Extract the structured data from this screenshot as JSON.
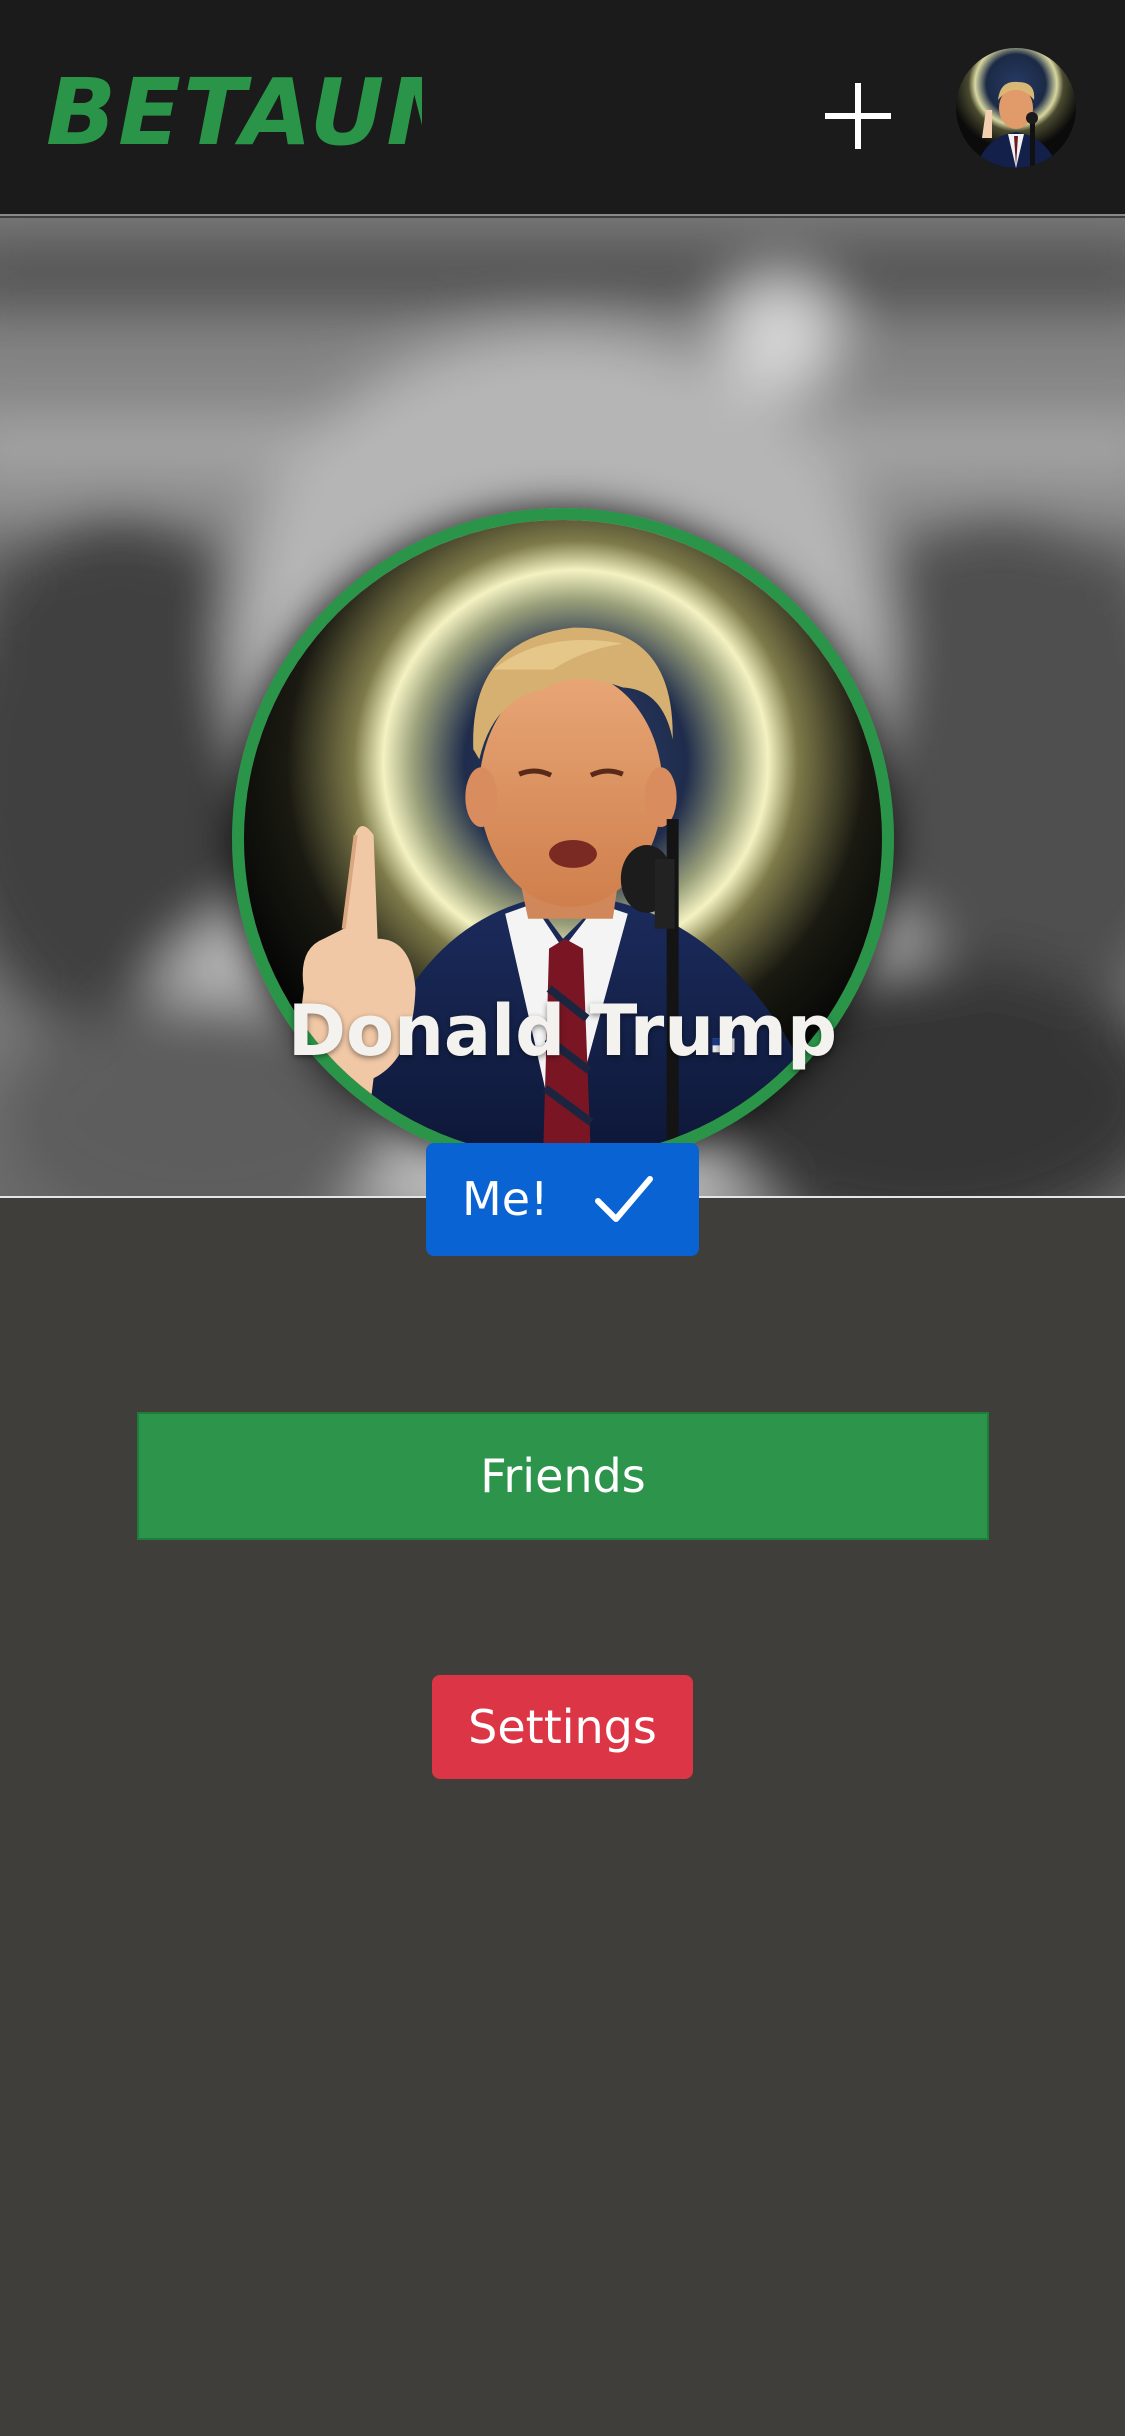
{
  "app": {
    "logo_text": "BETAUM",
    "brand_color": "#2a9448"
  },
  "header": {
    "add_icon": "plus-icon",
    "avatar_icon": "user-avatar"
  },
  "profile": {
    "name": "Donald Trump",
    "photo_border_color": "#2a9448"
  },
  "buttons": {
    "me_label": "Me!",
    "me_icon": "check-icon",
    "me_color": "#0a63d2",
    "friends_label": "Friends",
    "friends_color": "#2c944b",
    "settings_label": "Settings",
    "settings_color": "#dc3545"
  },
  "colors": {
    "topbar": "#1b1b1b",
    "page_background": "#403e3a",
    "name_text": "#f3f2ee"
  }
}
